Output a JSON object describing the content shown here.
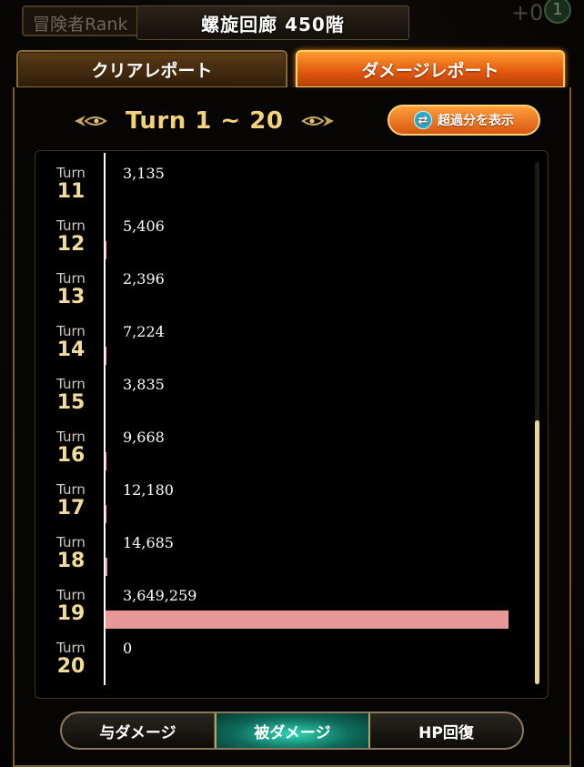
{
  "background": {
    "rank_label": "冒険者Rank",
    "rank_value_partial": "15",
    "plus_value": "+0",
    "badge": "1"
  },
  "header": {
    "title": "螺旋回廊 450階"
  },
  "tabs": [
    {
      "label": "クリアレポート",
      "active": false
    },
    {
      "label": "ダメージレポート",
      "active": true
    }
  ],
  "report": {
    "range_label": "Turn 1 ~ 20",
    "excess_button_label": "超過分を表示"
  },
  "chart_data": {
    "type": "bar",
    "orientation": "horizontal",
    "turn_word": "Turn",
    "categories": [
      "11",
      "12",
      "13",
      "14",
      "15",
      "16",
      "17",
      "18",
      "19",
      "20"
    ],
    "values": [
      3135,
      5406,
      2396,
      7224,
      3835,
      9668,
      12180,
      14685,
      3649259,
      0
    ],
    "value_labels": [
      "3,135",
      "5,406",
      "2,396",
      "7,224",
      "3,835",
      "9,668",
      "12,180",
      "14,685",
      "3,649,259",
      "0"
    ],
    "bar_color": "#e89898"
  },
  "bottom_tabs": [
    {
      "label": "与ダメージ",
      "active": false
    },
    {
      "label": "被ダメージ",
      "active": true
    },
    {
      "label": "HP回復",
      "active": false
    }
  ],
  "colors": {
    "accent_orange": "#e2560d",
    "gold": "#f3d27a",
    "active_teal": "#2fd6b8"
  }
}
